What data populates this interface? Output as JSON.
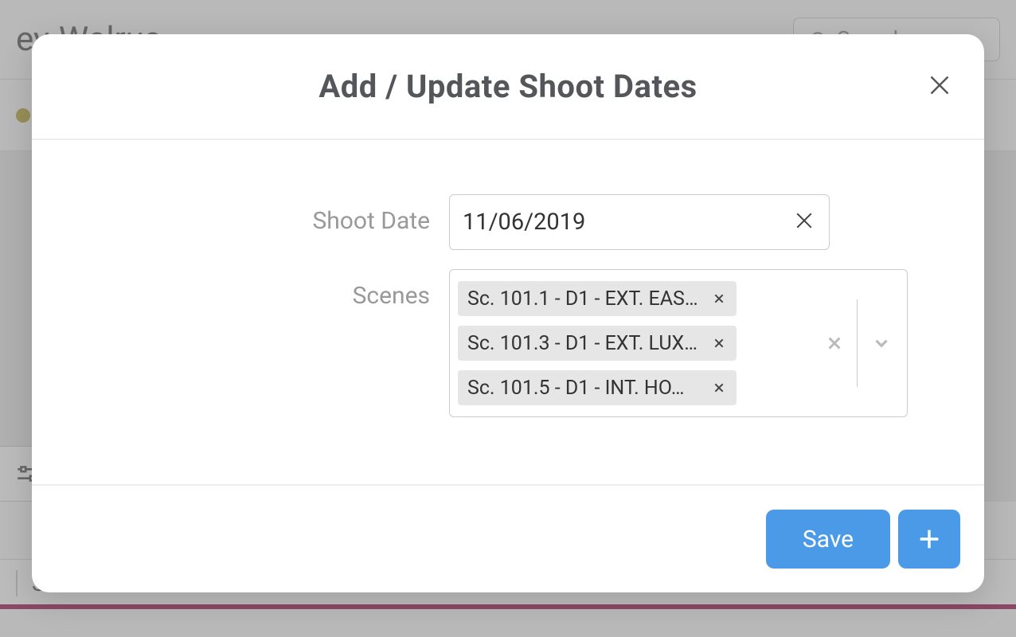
{
  "background": {
    "title_fragment_1": "ey",
    "title_fragment_2": "Walrus",
    "search_placeholder": "Search",
    "bottom_text": "S"
  },
  "modal": {
    "title": "Add / Update Shoot Dates",
    "shoot_date_label": "Shoot Date",
    "shoot_date_value": "11/06/2019",
    "scenes_label": "Scenes",
    "scenes": [
      {
        "label": "Sc. 101.1 - D1 - EXT. EAS…"
      },
      {
        "label": "Sc. 101.3 - D1 - EXT. LUX…"
      },
      {
        "label": "Sc. 101.5 - D1 - INT. HO…"
      }
    ],
    "save_label": "Save"
  }
}
